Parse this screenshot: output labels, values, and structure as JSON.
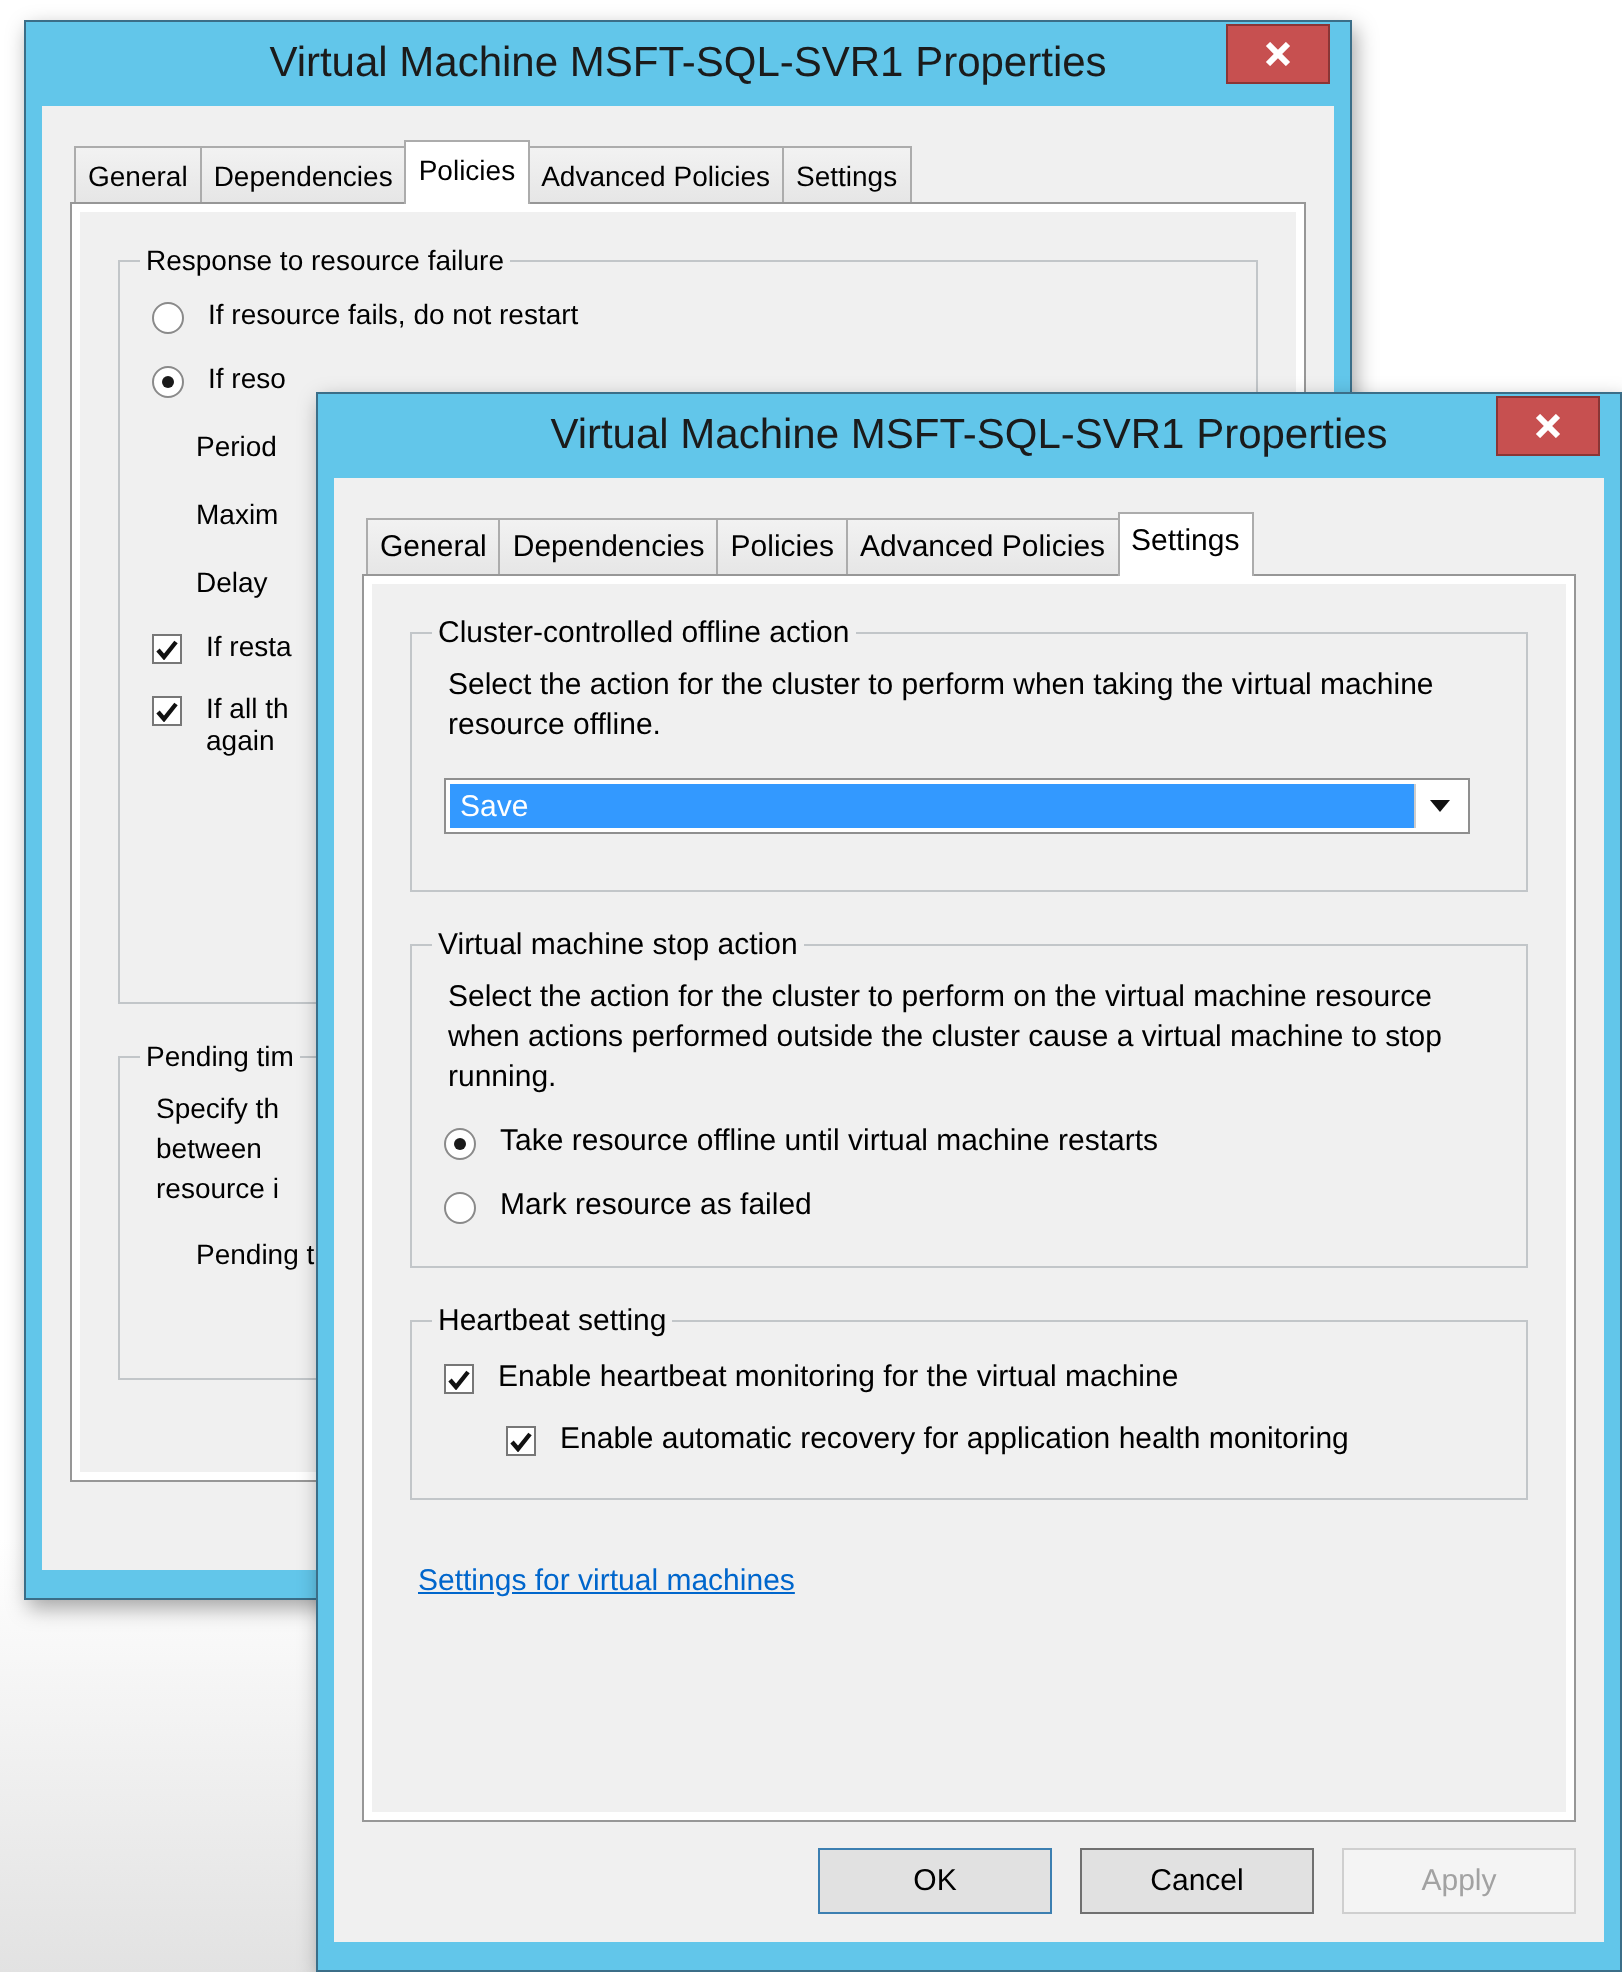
{
  "windows": [
    {
      "title": "Virtual Machine MSFT-SQL-SVR1 Properties",
      "tabs": [
        {
          "label": "General",
          "selected": false
        },
        {
          "label": "Dependencies",
          "selected": false
        },
        {
          "label": "Policies",
          "selected": true
        },
        {
          "label": "Advanced Policies",
          "selected": false
        },
        {
          "label": "Settings",
          "selected": false
        }
      ],
      "groups": [
        {
          "legend": "Response to resource failure",
          "items": [
            {
              "kind": "radio",
              "label": "If resource fails, do not restart",
              "selected": false
            },
            {
              "kind": "radio",
              "label": "If reso",
              "selected": true
            },
            {
              "kind": "label",
              "label": "Period"
            },
            {
              "kind": "label",
              "label": "Maxim"
            },
            {
              "kind": "label",
              "label": "Delay"
            },
            {
              "kind": "check",
              "lines": [
                "If resta"
              ],
              "checked": true
            },
            {
              "kind": "check",
              "lines": [
                "If all th",
                "again"
              ],
              "checked": true
            }
          ]
        },
        {
          "legend": "Pending tim",
          "items": [
            {
              "kind": "text",
              "lines": [
                "Specify th",
                "between",
                "resource i"
              ]
            },
            {
              "kind": "label",
              "label": "Pending t"
            }
          ]
        }
      ]
    },
    {
      "title": "Virtual Machine MSFT-SQL-SVR1 Properties",
      "tabs": [
        {
          "label": "General",
          "selected": false
        },
        {
          "label": "Dependencies",
          "selected": false
        },
        {
          "label": "Policies",
          "selected": false
        },
        {
          "label": "Advanced Policies",
          "selected": false
        },
        {
          "label": "Settings",
          "selected": true
        }
      ],
      "groups": [
        {
          "legend": "Cluster-controlled offline action",
          "items": [
            {
              "kind": "text",
              "lines": [
                "Select the action for the cluster to perform when taking the virtual machine resource offline."
              ]
            },
            {
              "kind": "dropdown",
              "value": "Save"
            }
          ]
        },
        {
          "legend": "Virtual machine stop action",
          "items": [
            {
              "kind": "text",
              "lines": [
                "Select the action for the cluster to perform on the virtual machine resource when actions performed outside the cluster cause a virtual machine to stop running."
              ]
            },
            {
              "kind": "radio",
              "label": "Take resource offline until virtual machine restarts",
              "selected": true
            },
            {
              "kind": "radio",
              "label": "Mark resource as failed",
              "selected": false
            }
          ]
        },
        {
          "legend": "Heartbeat setting",
          "items": [
            {
              "kind": "check",
              "lines": [
                "Enable heartbeat monitoring for the virtual machine"
              ],
              "checked": true,
              "children": [
                {
                  "kind": "check",
                  "lines": [
                    "Enable automatic recovery for application health monitoring"
                  ],
                  "checked": true
                }
              ]
            }
          ]
        }
      ],
      "link": "Settings for virtual machines",
      "buttons": [
        {
          "label": "OK",
          "default": true,
          "disabled": false
        },
        {
          "label": "Cancel",
          "default": false,
          "disabled": false
        },
        {
          "label": "Apply",
          "default": false,
          "disabled": true
        }
      ]
    }
  ]
}
